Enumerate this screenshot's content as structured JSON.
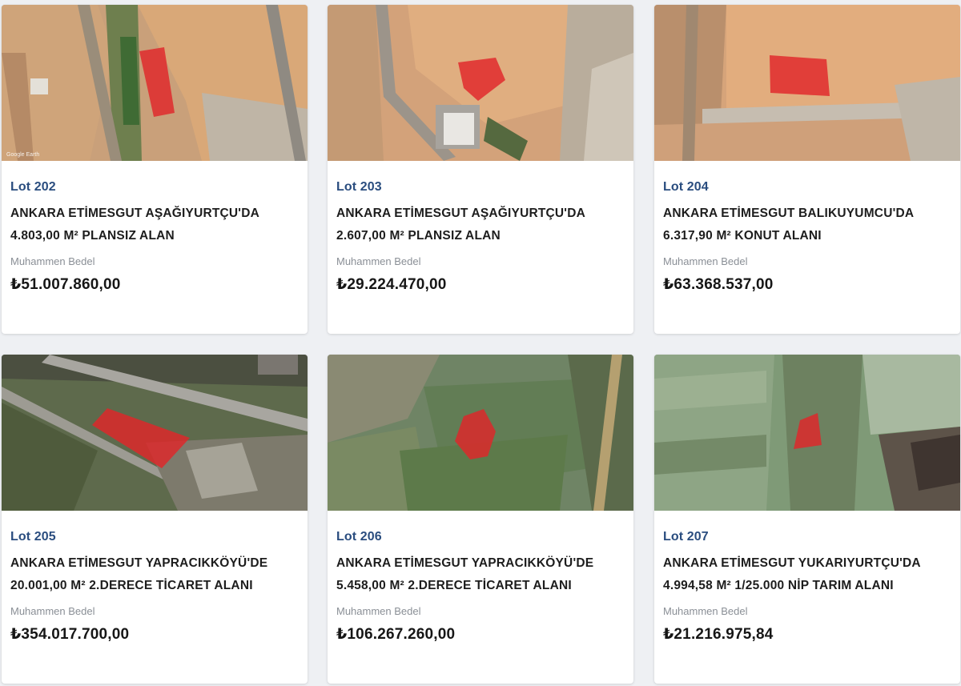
{
  "estimate_label": "Muhammen Bedel",
  "map_attribution": "Google Earth",
  "lots": [
    {
      "lot": "Lot 202",
      "title_line1": "ANKARA ETİMESGUT AŞAĞIYURTÇU'DA",
      "title_line2": "4.803,00 M² PLANSIZ ALAN",
      "price": "₺51.007.860,00",
      "terrain": "dry"
    },
    {
      "lot": "Lot 203",
      "title_line1": "ANKARA ETİMESGUT AŞAĞIYURTÇU'DA",
      "title_line2": "2.607,00 M² PLANSIZ ALAN",
      "price": "₺29.224.470,00",
      "terrain": "dry"
    },
    {
      "lot": "Lot 204",
      "title_line1": "ANKARA ETİMESGUT BALIKUYUMCU'DA",
      "title_line2": "6.317,90 M² KONUT ALANI",
      "price": "₺63.368.537,00",
      "terrain": "dry"
    },
    {
      "lot": "Lot 205",
      "title_line1": "ANKARA ETİMESGUT YAPRACIKKÖYÜ'DE",
      "title_line2": "20.001,00 M² 2.DERECE TİCARET ALANI",
      "price": "₺354.017.700,00",
      "terrain": "green"
    },
    {
      "lot": "Lot 206",
      "title_line1": "ANKARA ETİMESGUT YAPRACIKKÖYÜ'DE",
      "title_line2": "5.458,00 M² 2.DERECE TİCARET ALANI",
      "price": "₺106.267.260,00",
      "terrain": "green"
    },
    {
      "lot": "Lot 207",
      "title_line1": "ANKARA ETİMESGUT YUKARIYURTÇU'DA",
      "title_line2": "4.994,58 M² 1/25.000 NİP TARIM ALANI",
      "price": "₺21.216.975,84",
      "terrain": "green"
    }
  ],
  "colors": {
    "lot_blue": "#2a4d7f",
    "parcel_red": "#e0262a",
    "dry_field": "#d39a6a",
    "green_field": "#6f8a63"
  }
}
